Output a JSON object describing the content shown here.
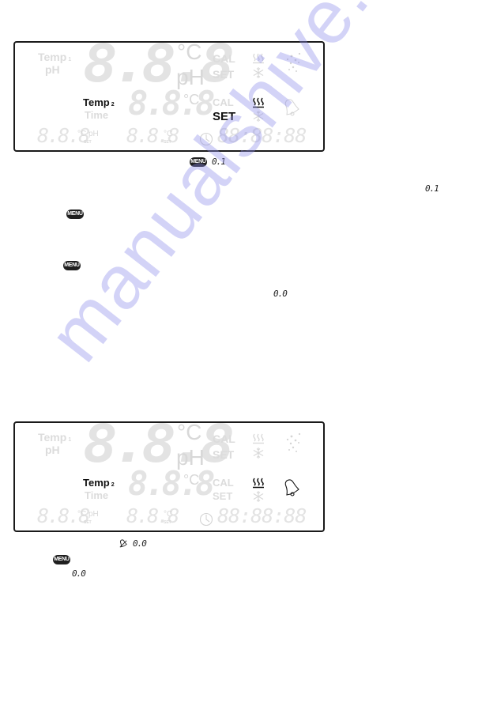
{
  "panels": [
    {
      "labels": {
        "temp1": "Temp",
        "temp1_sub": "1",
        "ph": "pH",
        "temp2": "Temp",
        "temp2_sub": "2",
        "time": "Time",
        "cal_top": "CAL",
        "set_top": "SET",
        "cal_bottom": "CAL",
        "set_bottom": "SET"
      },
      "digits": {
        "main": "8.8.8",
        "main_unit_c": "°C",
        "main_unit_ph": "pH",
        "second": "8.8.8",
        "second_unit": "°C",
        "small_left": "8.8.8",
        "small_left_unit": "°C pH",
        "small_left_set": "SET",
        "small_mid": "8.8.8",
        "small_mid_unit": "°C",
        "small_mid_set": "SET",
        "clock": "88:88:88"
      },
      "active": {
        "temp2": true,
        "set_bottom": true,
        "heat_bottom": true,
        "alarm_bell": false
      }
    },
    {
      "labels": {
        "temp1": "Temp",
        "temp1_sub": "1",
        "ph": "pH",
        "temp2": "Temp",
        "temp2_sub": "2",
        "time": "Time",
        "cal_top": "CAL",
        "set_top": "SET",
        "cal_bottom": "CAL",
        "set_bottom": "SET"
      },
      "digits": {
        "main": "8.8.8",
        "main_unit_c": "°C",
        "main_unit_ph": "pH",
        "second": "8.8.8",
        "second_unit": "°C",
        "small_left": "8.8.8",
        "small_left_unit": "°C pH",
        "small_left_set": "SET",
        "small_mid": "8.8.8",
        "small_mid_unit": "°C",
        "small_mid_set": "SET",
        "clock": "88:88:88"
      },
      "active": {
        "temp2": true,
        "set_bottom": false,
        "heat_bottom": true,
        "alarm_bell": true
      }
    }
  ],
  "inline": {
    "menu_label": "MENU",
    "value_01": "0.1",
    "value_00": "0.0"
  },
  "icons": {
    "heat": "heating-icon",
    "cool": "snowflake-icon",
    "aeration": "bubbles-icon",
    "alarm": "bell-icon",
    "clock": "clock-icon",
    "alarm_mute": "bell-mute-icon"
  },
  "colors": {
    "segment_on": "#111111",
    "segment_off": "#dcdcdc",
    "watermark": "#8c8ceb"
  },
  "watermark": "manualshive.com"
}
